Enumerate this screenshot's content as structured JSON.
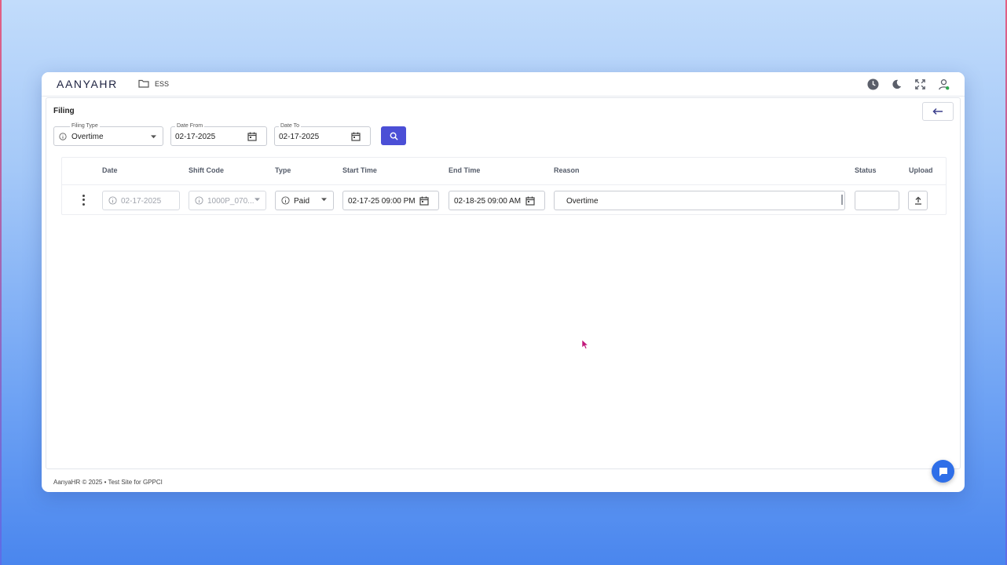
{
  "app": {
    "logo": "AANYAHR",
    "breadcrumb": "ESS"
  },
  "page": {
    "title": "Filing"
  },
  "filters": {
    "filing_type": {
      "label": "Filing Type",
      "value": "Overtime"
    },
    "date_from": {
      "label": "Date From",
      "value": "02-17-2025"
    },
    "date_to": {
      "label": "Date To",
      "value": "02-17-2025"
    }
  },
  "table": {
    "headers": {
      "date": "Date",
      "shift_code": "Shift Code",
      "type": "Type",
      "start_time": "Start Time",
      "end_time": "End Time",
      "reason": "Reason",
      "status": "Status",
      "upload": "Upload"
    },
    "rows": [
      {
        "date": "02-17-2025",
        "shift_code": "1000P_070...",
        "type": "Paid",
        "start_time": "02-17-25 09:00 PM",
        "end_time": "02-18-25 09:00 AM",
        "reason": "Overtime",
        "status": ""
      }
    ]
  },
  "footer": {
    "text": "AanyaHR © 2025 • Test Site for GPPCI"
  },
  "colors": {
    "accent": "#4b4fd6",
    "chat": "#2f6fe8",
    "background_top": "#c2dcfb",
    "background_bottom": "#4a86ee"
  }
}
